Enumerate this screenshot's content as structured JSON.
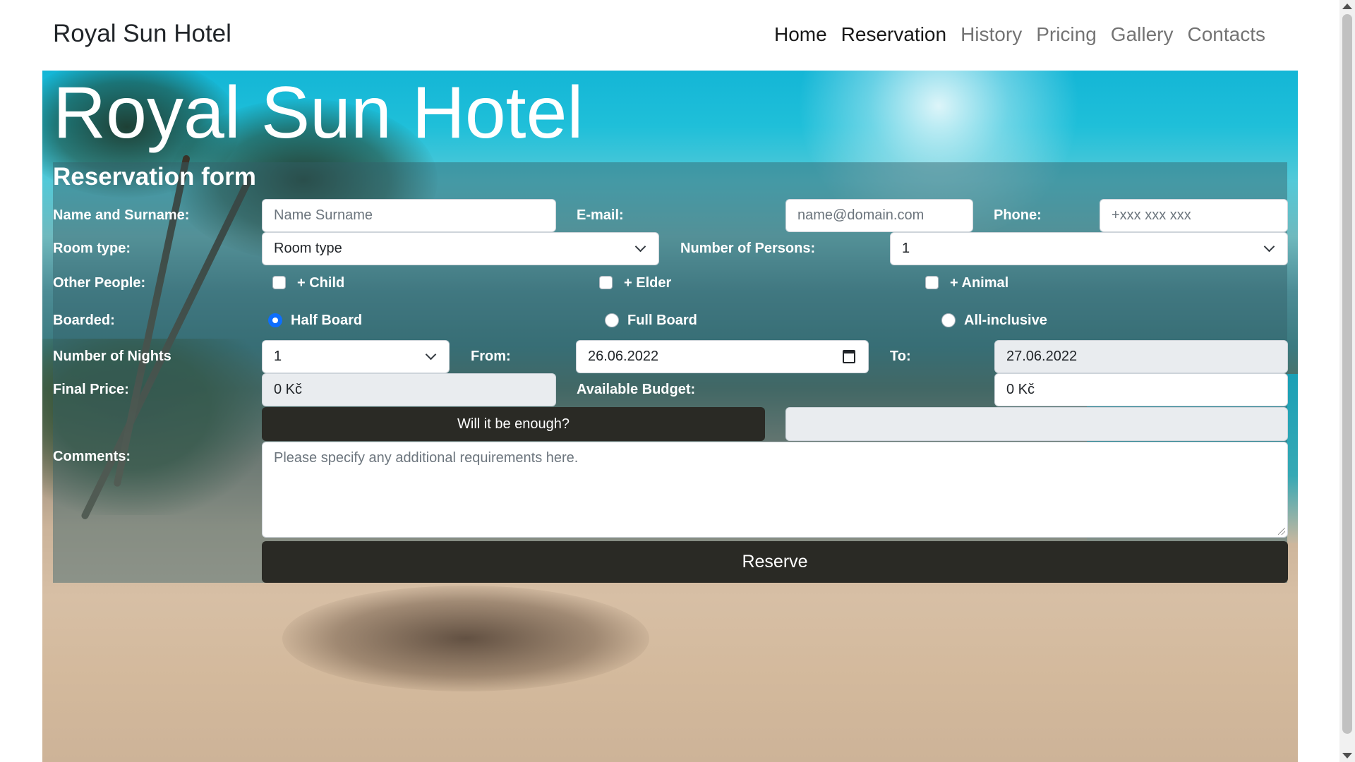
{
  "navbar": {
    "brand": "Royal Sun Hotel",
    "links": [
      "Home",
      "Reservation",
      "History",
      "Pricing",
      "Gallery",
      "Contacts"
    ]
  },
  "hero": {
    "title": "Royal Sun Hotel"
  },
  "form": {
    "heading": "Reservation form",
    "name_label": "Name and Surname:",
    "name_placeholder": "Name Surname",
    "email_label": "E-mail:",
    "email_placeholder": "name@domain.com",
    "phone_label": "Phone:",
    "phone_placeholder": "+xxx xxx xxx",
    "room_type_label": "Room type:",
    "room_type_value": "Room type",
    "persons_label": "Number of Persons:",
    "persons_value": "1",
    "other_people_label": "Other People:",
    "other_options": [
      "+ Child",
      "+ Elder",
      "+ Animal"
    ],
    "boarded_label": "Boarded:",
    "board_options": [
      "Half Board",
      "Full Board",
      "All-inclusive"
    ],
    "board_selected": "Half Board",
    "nights_label": "Number of Nights",
    "nights_value": "1",
    "from_label": "From:",
    "from_value": "26.06.2022",
    "to_label": "To:",
    "to_value": "27.06.2022",
    "final_price_label": "Final Price:",
    "final_price_value": "0 Kč",
    "budget_label": "Available Budget:",
    "budget_value": "0 Kč",
    "check_button": "Will it be enough?",
    "comments_label": "Comments:",
    "comments_placeholder": "Please specify any additional requirements here.",
    "reserve_button": "Reserve"
  },
  "colors": {
    "button_dark": "#2a2a25",
    "radio_selected": "#0d6efd",
    "panel_overlay": "rgba(50,95,105,0.45)"
  }
}
